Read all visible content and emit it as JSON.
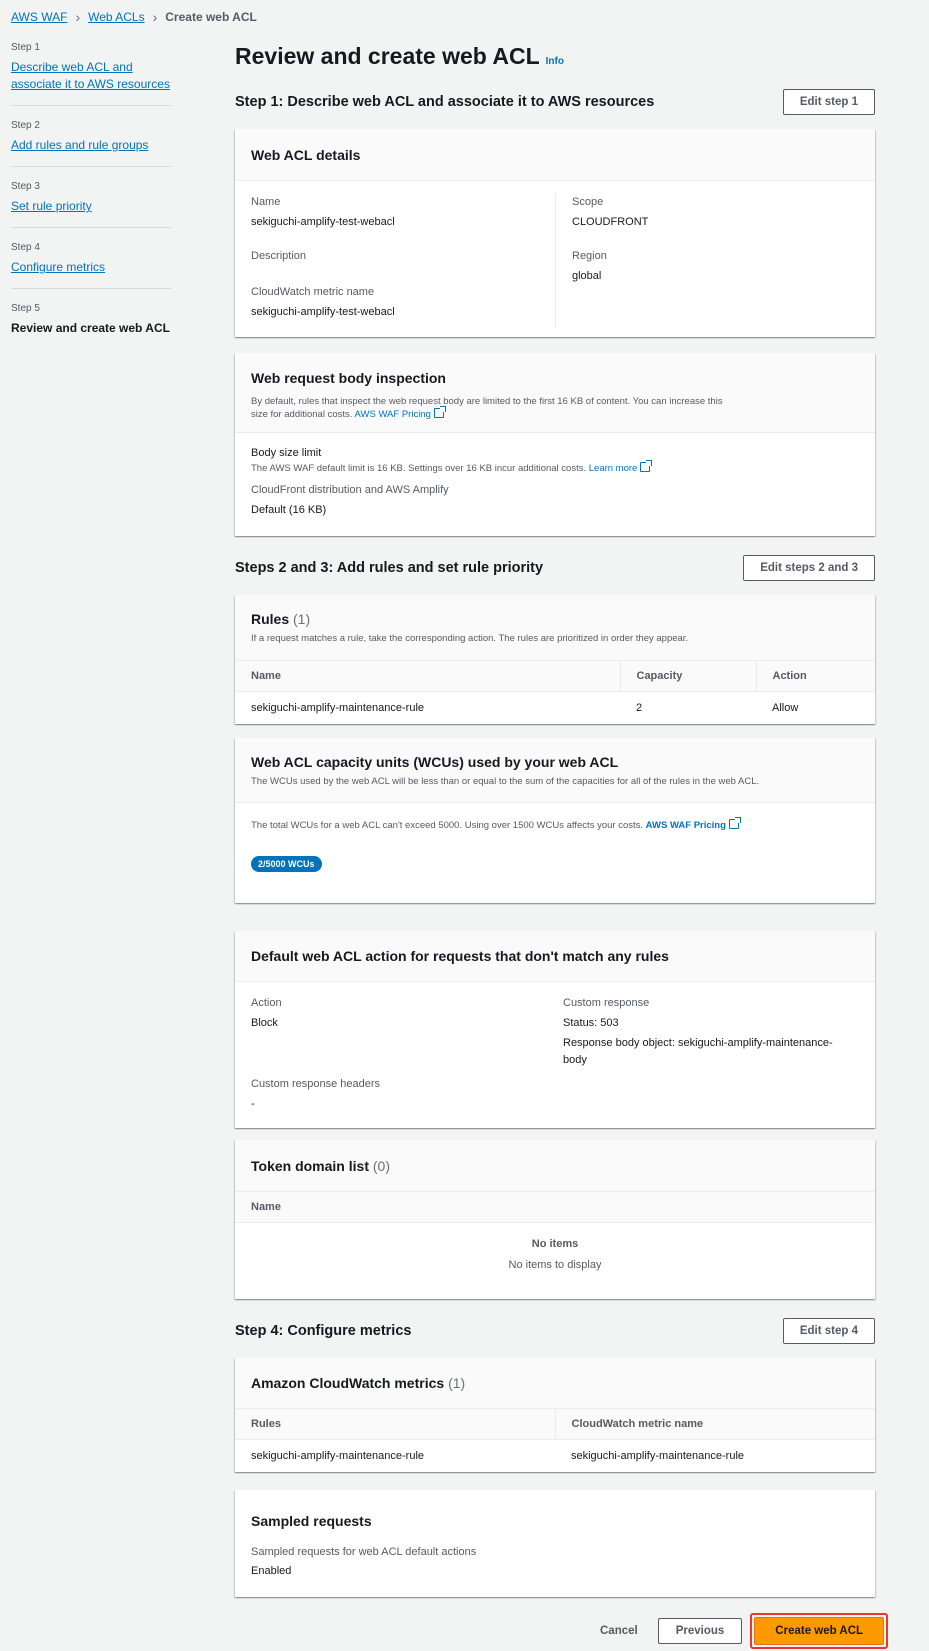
{
  "breadcrumb": [
    "AWS WAF",
    "Web ACLs",
    "Create web ACL"
  ],
  "nav": [
    {
      "label": "Step 1",
      "title": "Describe web ACL and associate it to AWS resources"
    },
    {
      "label": "Step 2",
      "title": "Add rules and rule groups"
    },
    {
      "label": "Step 3",
      "title": "Set rule priority"
    },
    {
      "label": "Step 4",
      "title": "Configure metrics"
    },
    {
      "label": "Step 5",
      "title": "Review and create web ACL"
    }
  ],
  "page": {
    "title": "Review and create web ACL",
    "info": "Info"
  },
  "step1": {
    "heading": "Step 1: Describe web ACL and associate it to AWS resources",
    "edit": "Edit step 1",
    "details": {
      "title": "Web ACL details",
      "name_k": "Name",
      "name_v": "sekiguchi-amplify-test-webacl",
      "desc_k": "Description",
      "metric_k": "CloudWatch metric name",
      "metric_v": "sekiguchi-amplify-test-webacl",
      "scope_k": "Scope",
      "scope_v": "CLOUDFRONT",
      "region_k": "Region",
      "region_v": "global"
    },
    "body": {
      "title": "Web request body inspection",
      "desc": "By default, rules that inspect the web request body are limited to the first 16 KB of content. You can increase this size for additional costs.",
      "pricing": "AWS WAF Pricing",
      "limit_k": "Body size limit",
      "limit_desc": "The AWS WAF default limit is 16 KB. Settings over 16 KB incur additional costs.",
      "learn": "Learn more",
      "cf_k": "CloudFront distribution and AWS Amplify",
      "cf_v": "Default (16 KB)"
    }
  },
  "step23": {
    "heading": "Steps 2 and 3: Add rules and set rule priority",
    "edit": "Edit steps 2 and 3",
    "rules": {
      "title": "Rules",
      "count": "(1)",
      "desc": "If a request matches a rule, take the corresponding action. The rules are prioritized in order they appear.",
      "cols": [
        "Name",
        "Capacity",
        "Action"
      ],
      "rows": [
        [
          "sekiguchi-amplify-maintenance-rule",
          "2",
          "Allow"
        ]
      ]
    },
    "wcu": {
      "title": "Web ACL capacity units (WCUs) used by your web ACL",
      "desc": "The WCUs used by the web ACL will be less than or equal to the sum of the capacities for all of the rules in the web ACL.",
      "note": "The total WCUs for a web ACL can't exceed 5000. Using over 1500 WCUs affects your costs.",
      "pricing": "AWS WAF Pricing",
      "badge": "2/5000 WCUs"
    },
    "default": {
      "title": "Default web ACL action for requests that don't match any rules",
      "action_k": "Action",
      "action_v": "Block",
      "resp_k": "Custom response",
      "resp_status": "Status: 503",
      "resp_body": "Response body object: sekiguchi-amplify-maintenance-body",
      "headers_k": "Custom response headers",
      "headers_v": "-"
    },
    "token": {
      "title": "Token domain list",
      "count": "(0)",
      "col": "Name",
      "empty_t": "No items",
      "empty_d": "No items to display"
    }
  },
  "step4": {
    "heading": "Step 4: Configure metrics",
    "edit": "Edit step 4",
    "cw": {
      "title": "Amazon CloudWatch metrics",
      "count": "(1)",
      "cols": [
        "Rules",
        "CloudWatch metric name"
      ],
      "rows": [
        [
          "sekiguchi-amplify-maintenance-rule",
          "sekiguchi-amplify-maintenance-rule"
        ]
      ]
    },
    "sampled": {
      "title": "Sampled requests",
      "k": "Sampled requests for web ACL default actions",
      "v": "Enabled"
    }
  },
  "footer": {
    "cancel": "Cancel",
    "previous": "Previous",
    "create": "Create web ACL"
  }
}
